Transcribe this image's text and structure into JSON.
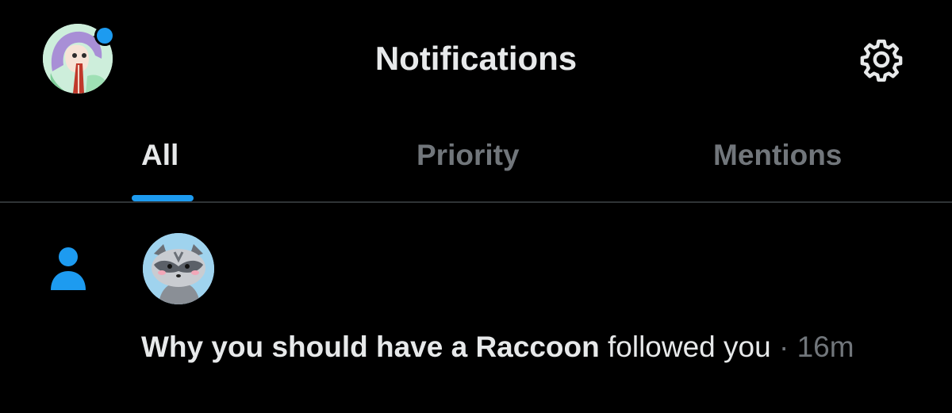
{
  "header": {
    "title": "Notifications",
    "avatar_icon": "user-avatar",
    "settings_icon": "gear-icon",
    "unread_dot": true
  },
  "tabs": [
    {
      "label": "All",
      "active": true
    },
    {
      "label": "Priority",
      "active": false
    },
    {
      "label": "Mentions",
      "active": false
    }
  ],
  "notifications": [
    {
      "type_icon": "person-icon",
      "avatar_icon": "raccoon-avatar",
      "name": "Why you should have a Raccoon",
      "action": "followed you",
      "separator": "·",
      "time": "16m"
    }
  ],
  "colors": {
    "background": "#000000",
    "accent": "#1d9bf0",
    "primary_text": "#e7e9ea",
    "secondary_text": "#71767b",
    "divider": "#2f3336"
  }
}
